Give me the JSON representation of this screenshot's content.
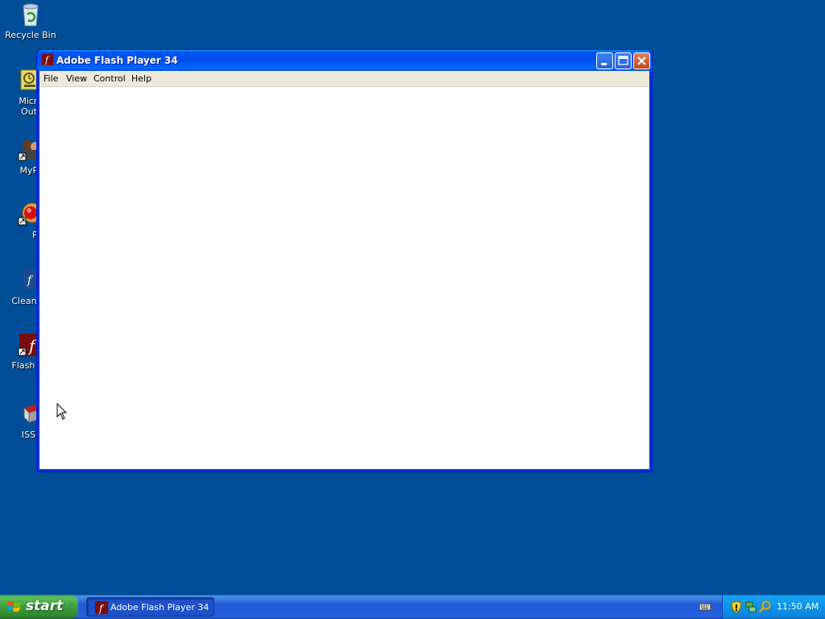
{
  "desktop": {
    "icons": [
      {
        "label": "Recycle Bin",
        "icon": "recycle-bin-icon"
      },
      {
        "label": "Micros\nOutlo",
        "icon": "outlook-icon"
      },
      {
        "label": "MyPa",
        "icon": "mypa-icon"
      },
      {
        "label": "Peg",
        "icon": "pegasus-icon"
      },
      {
        "label": "CleanFla",
        "icon": "cleanflash-icon"
      },
      {
        "label": "Flash P",
        "icon": "flash-player-icon"
      },
      {
        "label": "ISSp",
        "icon": "issp-icon"
      }
    ]
  },
  "window": {
    "title": "Adobe Flash Player 34",
    "menu": [
      "File",
      "View",
      "Control",
      "Help"
    ]
  },
  "taskbar": {
    "start_label": "start",
    "task_label": "Adobe Flash Player 34",
    "clock": "11:50 AM"
  },
  "colors": {
    "desktop": "#004e98",
    "titlebar": "#0053ee",
    "start": "#3c9a3c",
    "close": "#c4441a"
  }
}
